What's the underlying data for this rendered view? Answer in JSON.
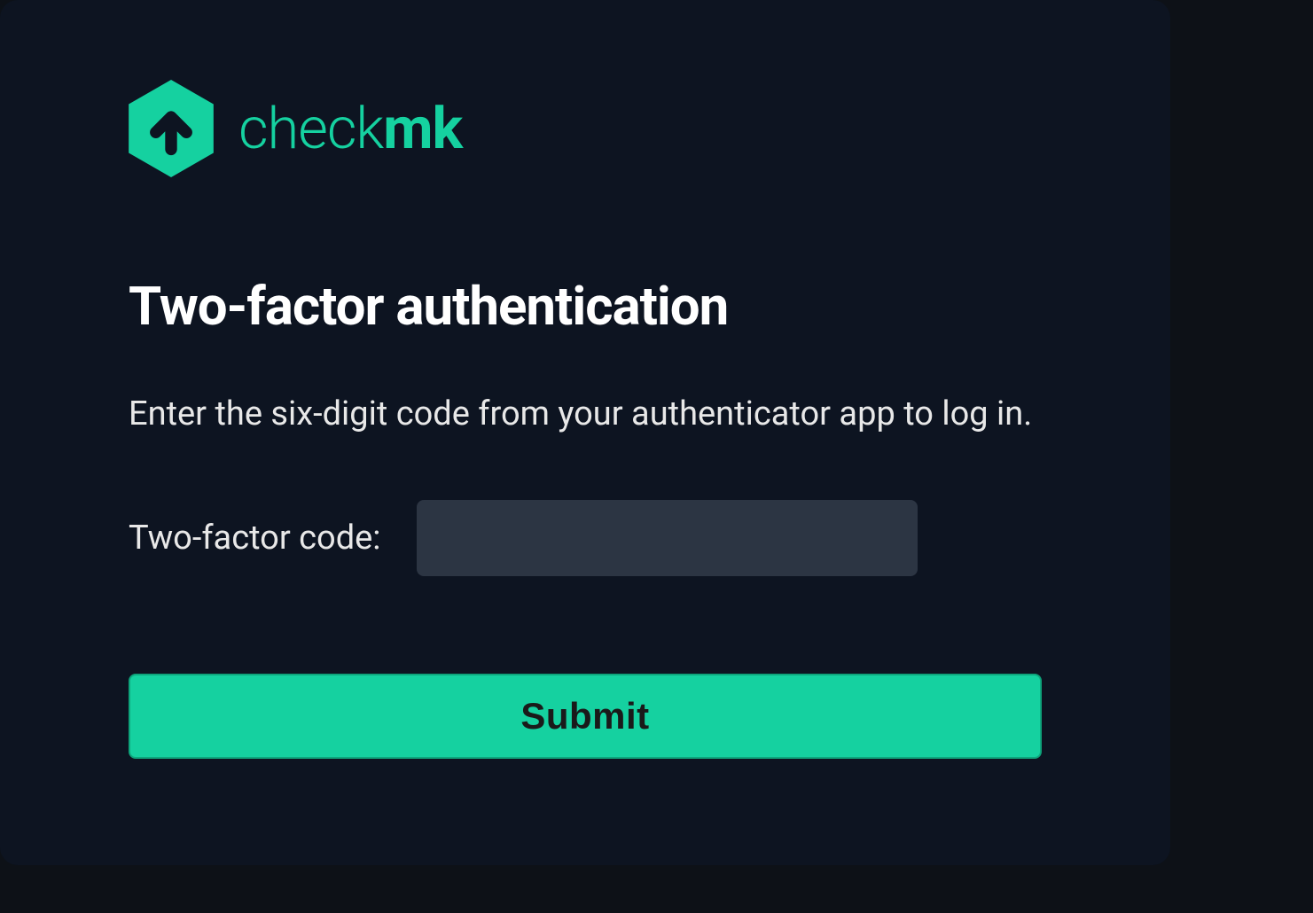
{
  "logo": {
    "text_light": "check",
    "text_bold": "mk"
  },
  "title": "Two-factor authentication",
  "description": "Enter the six-digit code from your authenticator app to log in.",
  "form": {
    "label": "Two-factor code:",
    "input_value": "",
    "submit_label": "Submit"
  },
  "colors": {
    "accent": "#15d1a0",
    "background": "#0d1421",
    "input_background": "#2c3543"
  }
}
